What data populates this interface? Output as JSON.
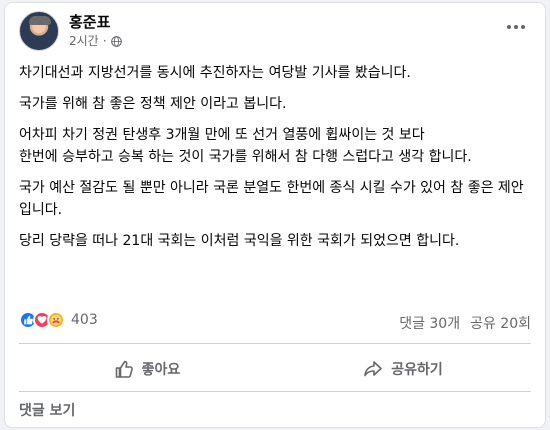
{
  "post": {
    "author": "홍준표",
    "time": "2시간",
    "privacy_icon": "globe-icon",
    "paragraphs": [
      "차기대선과 지방선거를 동시에 추진하자는 여당발 기사를 봤습니다.",
      "국가를 위해 참 좋은  정책 제안 이라고 봅니다.",
      "어차피 차기 정권 탄생후 3개월 만에 또 선거 열풍에 휩싸이는 것 보다",
      "한번에 승부하고 승복 하는 것이 국가를 위해서 참 다행 스럽다고  생각 합니다.",
      "국가 예산 절감도 될 뿐만 아니라 국론 분열도 한번에 종식 시킬 수가 있어 참 좋은 제안 입니다.",
      "당리 당략을 떠나 21대 국회는 이처럼 국익을 위한 국회가 되었으면 합니다."
    ]
  },
  "reactions": {
    "icons": [
      "like-icon",
      "love-icon",
      "care-icon"
    ],
    "count": "403"
  },
  "stats": {
    "comments": "댓글 30개",
    "shares": "공유 20회"
  },
  "actions": {
    "like_label": "좋아요",
    "share_label": "공유하기"
  },
  "footer": {
    "view_comments": "댓글 보기"
  },
  "colors": {
    "like": "#1877f2",
    "love": "#f33e58",
    "care": "#f7b125",
    "muted_text": "#65676b"
  }
}
